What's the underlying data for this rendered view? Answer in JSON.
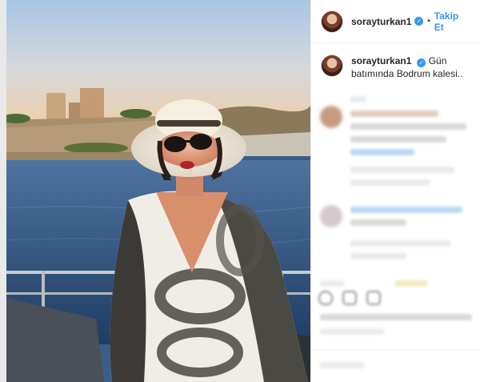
{
  "post": {
    "username": "sorayturkan1",
    "verified_icon": "verified-badge-icon",
    "follow_label": "Takip Et",
    "separator": "•",
    "caption": "Gün batımında Bodrum kalesi.."
  },
  "colors": {
    "link_blue": "#3897f0",
    "text": "#262626",
    "divider": "#efefef"
  }
}
